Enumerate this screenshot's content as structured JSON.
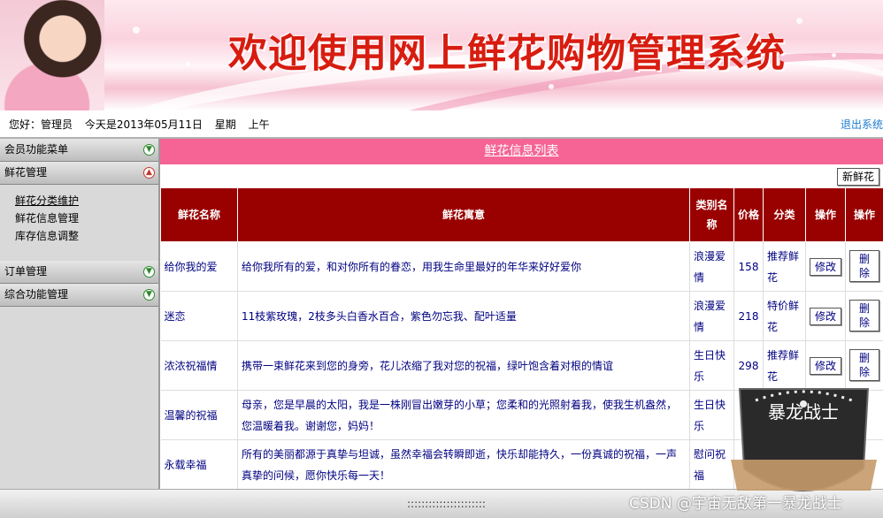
{
  "banner": {
    "title": "欢迎使用网上鲜花购物管理系统"
  },
  "infobar": {
    "greeting": "您好：管理员",
    "date": "今天是2013年05月11日",
    "weekday": "星期",
    "ampm": "上午",
    "logout": "退出系统"
  },
  "sidebar": {
    "menus": [
      {
        "label": "会员功能菜单",
        "expanded": false
      },
      {
        "label": "鲜花管理",
        "expanded": true,
        "items": [
          "鲜花分类维护",
          "鲜花信息管理",
          "库存信息调整"
        ]
      },
      {
        "label": "订单管理",
        "expanded": false
      },
      {
        "label": "综合功能管理",
        "expanded": false
      }
    ]
  },
  "main": {
    "title": "鲜花信息列表",
    "new_button": "新鲜花",
    "columns": [
      "鲜花名称",
      "鲜花寓意",
      "类别名称",
      "价格",
      "分类",
      "操作",
      "操作"
    ],
    "rows": [
      {
        "name": "给你我的爱",
        "meaning": "给你我所有的爱，和对你所有的眷恋，用我生命里最好的年华来好好爱你",
        "category": "浪漫爱情",
        "price": "158",
        "type": "推荐鲜花",
        "edit": "修改",
        "delete": "删除"
      },
      {
        "name": "迷恋",
        "meaning": "11枝紫玫瑰，2枝多头白香水百合，紫色勿忘我、配叶适量",
        "category": "浪漫爱情",
        "price": "218",
        "type": "特价鲜花",
        "edit": "修改",
        "delete": "删除"
      },
      {
        "name": "浓浓祝福情",
        "meaning": "携带一束鲜花来到您的身旁，花儿浓缩了我对您的祝福，绿叶饱含着对根的情谊",
        "category": "生日快乐",
        "price": "298",
        "type": "推荐鲜花",
        "edit": "修改",
        "delete": "删除"
      },
      {
        "name": "温馨的祝福",
        "meaning": "母亲，您是早晨的太阳，我是一株刚冒出嫩芽的小草；您柔和的光照射着我，使我生机盎然，您温暖着我。谢谢您，妈妈！",
        "category": "生日快乐",
        "price": "",
        "type": "",
        "edit": "",
        "delete": ""
      },
      {
        "name": "永载幸福",
        "meaning": "所有的美丽都源于真挚与坦诚，虽然幸福会转瞬即逝，快乐却能持久，一份真诚的祝福，一声真挚的问候，愿你快乐每一天！",
        "category": "慰问祝福",
        "price": "",
        "type": "",
        "edit": "",
        "delete": ""
      }
    ]
  },
  "footer": {
    "text": "::::::::::::::::::::::"
  },
  "watermark": {
    "badge": "暴龙战士",
    "csdn": "CSDN @宇宙无敌第一暴龙战士"
  }
}
